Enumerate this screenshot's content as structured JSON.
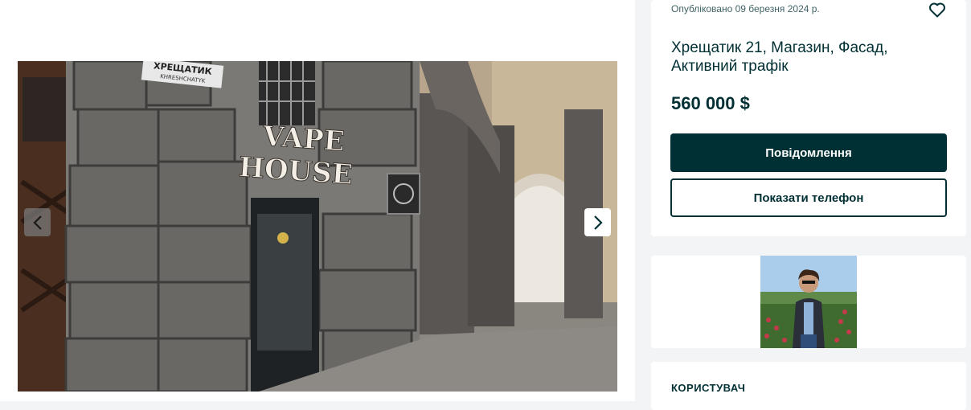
{
  "listing": {
    "published": "Опубліковано 09 березня 2024 р.",
    "title": "Хрещатик 21, Магазин, Фасад, Активний трафік",
    "price": "560 000 $",
    "message_button": "Повідомлення",
    "phone_button": "Показати телефон"
  },
  "gallery": {
    "sign_line1": "VAPE",
    "sign_line2": "HOUSE",
    "street_plate": "ХРЕЩАТИК",
    "street_plate_sub": "KHRESHCHATYK"
  },
  "user": {
    "heading": "КОРИСТУВАЧ"
  },
  "icons": {
    "favorite": "heart-outline-icon",
    "prev": "chevron-left-icon",
    "next": "chevron-right-icon"
  },
  "colors": {
    "primary": "#002f34",
    "muted": "#406367",
    "page_bg": "#f2f4f5"
  }
}
